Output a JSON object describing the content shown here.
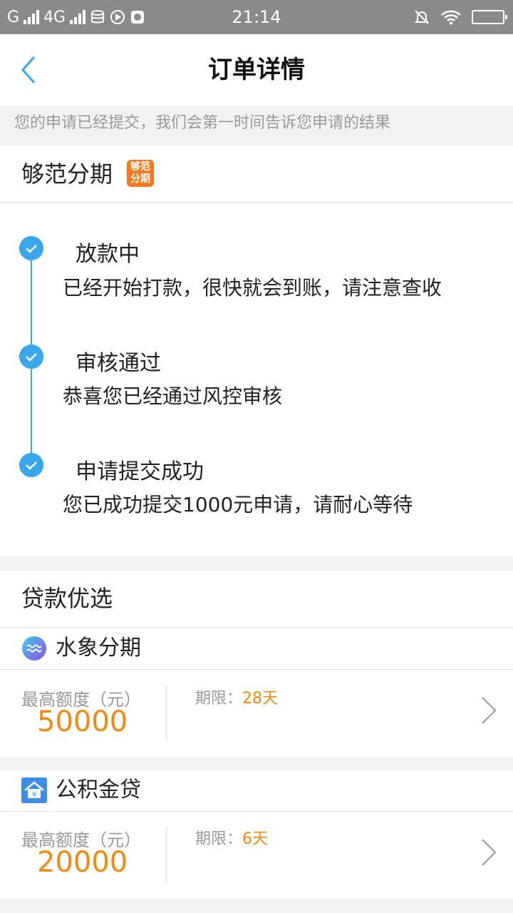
{
  "status_bar": {
    "carrier1": "G",
    "carrier2": "4G",
    "time": "21:14"
  },
  "header": {
    "title": "订单详情",
    "back_icon": "chevron-left-icon"
  },
  "notice": "您的申请已经提交，我们会第一时间告诉您申请的结果",
  "provider": {
    "name": "够范分期",
    "logo_text": "够范分期"
  },
  "timeline": [
    {
      "title": "放款中",
      "desc": "已经开始打款，很快就会到账，请注意查收"
    },
    {
      "title": "审核通过",
      "desc": "恭喜您已经通过风控审核"
    },
    {
      "title": "申请提交成功",
      "desc": "您已成功提交1000元申请，请耐心等待"
    }
  ],
  "section": {
    "title": "贷款优选"
  },
  "loans": [
    {
      "name": "水象分期",
      "quota_label": "最高额度（元）",
      "quota": "50000",
      "term_label": "期限：",
      "term": "28天",
      "icon": "water-wave-icon"
    },
    {
      "name": "公积金贷",
      "quota_label": "最高额度（元）",
      "quota": "20000",
      "term_label": "期限：",
      "term": "6天",
      "icon": "house-yen-icon"
    }
  ],
  "colors": {
    "accent": "#3aa7ec",
    "amount": "#f08a14",
    "status_bar": "#8a8a8a"
  }
}
